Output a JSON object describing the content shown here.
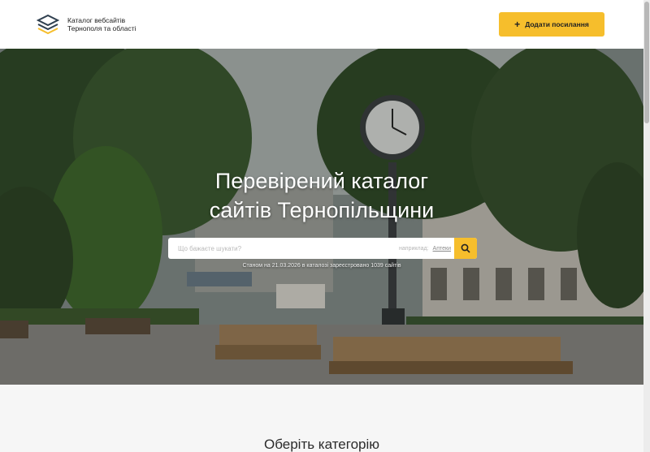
{
  "header": {
    "logo_icon": "layers-icon",
    "logo_line1": "Каталог вебсайтів",
    "logo_line2": "Тернополя та області",
    "add_button_icon": "plus-icon",
    "add_button_label": "Додати посилання"
  },
  "hero": {
    "title_line1": "Перевірений каталог",
    "title_line2": "сайтів Тернопільщини",
    "search": {
      "placeholder": "Що бажаєте шукати?",
      "hint": "наприклад:",
      "hint_link": "Аптеки",
      "button_icon": "search-icon"
    },
    "stats_text": "Станом на 21.03.2026 в каталозі зареєстровано 1039 сайтів"
  },
  "categories": {
    "title": "Оберіть категорію"
  },
  "colors": {
    "accent": "#f6be2c",
    "text": "#222222",
    "hero_overlay": "#141816"
  }
}
